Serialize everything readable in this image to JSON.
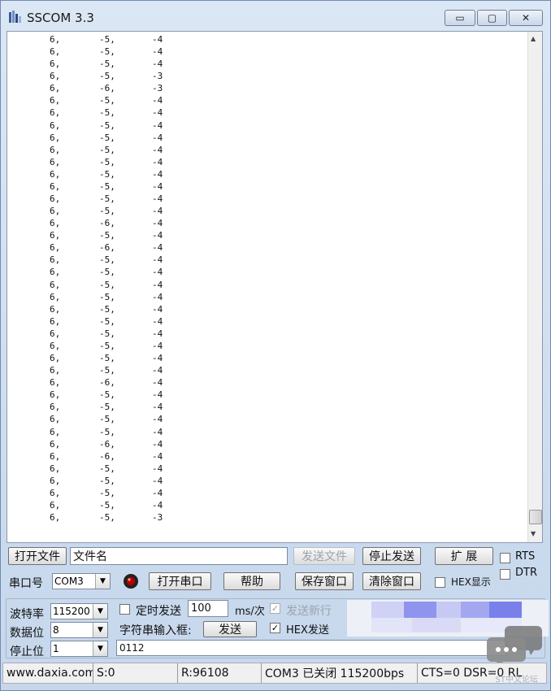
{
  "window": {
    "title": "SSCOM 3.3",
    "min_label": "▭",
    "max_label": "▢",
    "close_label": "✕"
  },
  "console": {
    "rows": [
      [
        "6,",
        "-5,",
        "-4"
      ],
      [
        "6,",
        "-5,",
        "-4"
      ],
      [
        "6,",
        "-5,",
        "-4"
      ],
      [
        "6,",
        "-5,",
        "-3"
      ],
      [
        "6,",
        "-6,",
        "-3"
      ],
      [
        "6,",
        "-5,",
        "-4"
      ],
      [
        "6,",
        "-5,",
        "-4"
      ],
      [
        "6,",
        "-5,",
        "-4"
      ],
      [
        "6,",
        "-5,",
        "-4"
      ],
      [
        "6,",
        "-5,",
        "-4"
      ],
      [
        "6,",
        "-5,",
        "-4"
      ],
      [
        "6,",
        "-5,",
        "-4"
      ],
      [
        "6,",
        "-5,",
        "-4"
      ],
      [
        "6,",
        "-5,",
        "-4"
      ],
      [
        "6,",
        "-5,",
        "-4"
      ],
      [
        "6,",
        "-6,",
        "-4"
      ],
      [
        "6,",
        "-5,",
        "-4"
      ],
      [
        "6,",
        "-6,",
        "-4"
      ],
      [
        "6,",
        "-5,",
        "-4"
      ],
      [
        "6,",
        "-5,",
        "-4"
      ],
      [
        "6,",
        "-5,",
        "-4"
      ],
      [
        "6,",
        "-5,",
        "-4"
      ],
      [
        "6,",
        "-5,",
        "-4"
      ],
      [
        "6,",
        "-5,",
        "-4"
      ],
      [
        "6,",
        "-5,",
        "-4"
      ],
      [
        "6,",
        "-5,",
        "-4"
      ],
      [
        "6,",
        "-5,",
        "-4"
      ],
      [
        "6,",
        "-5,",
        "-4"
      ],
      [
        "6,",
        "-6,",
        "-4"
      ],
      [
        "6,",
        "-5,",
        "-4"
      ],
      [
        "6,",
        "-5,",
        "-4"
      ],
      [
        "6,",
        "-5,",
        "-4"
      ],
      [
        "6,",
        "-5,",
        "-4"
      ],
      [
        "6,",
        "-6,",
        "-4"
      ],
      [
        "6,",
        "-6,",
        "-4"
      ],
      [
        "6,",
        "-5,",
        "-4"
      ],
      [
        "6,",
        "-5,",
        "-4"
      ],
      [
        "6,",
        "-5,",
        "-4"
      ],
      [
        "6,",
        "-5,",
        "-4"
      ],
      [
        "6,",
        "-5,",
        "-3"
      ]
    ]
  },
  "controls": {
    "open_file": "打开文件",
    "file_name": "文件名",
    "send_file": "发送文件",
    "stop_send": "停止发送",
    "expand": "扩 展",
    "rts": "RTS",
    "dtr": "DTR",
    "port_label": "串口号",
    "port_value": "COM3",
    "open_port": "打开串口",
    "help": "帮助",
    "save_window": "保存窗口",
    "clear_window": "清除窗口",
    "hex_display": "HEX显示",
    "baud_label": "波特率",
    "baud_value": "115200",
    "databits_label": "数据位",
    "databits_value": "8",
    "stopbits_label": "停止位",
    "stopbits_value": "1",
    "timed_send": "定时发送",
    "interval_value": "100",
    "interval_unit": "ms/次",
    "send_newline": "发送新行",
    "string_input_label": "字符串输入框:",
    "send": "发送",
    "hex_send": "HEX发送",
    "input_value": "0112",
    "check_mark": "✓"
  },
  "statusbar": {
    "site": "www.daxia.com",
    "sent": "S:0",
    "received": "R:96108",
    "port_state": "COM3 已关闭  115200bps",
    "lines": "CTS=0 DSR=0 RL",
    "watermark": "ST中文论坛"
  }
}
